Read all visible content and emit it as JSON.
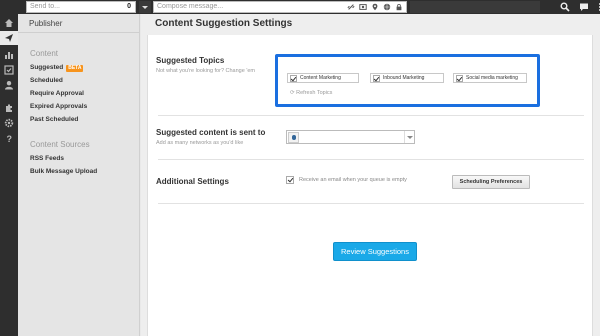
{
  "topbar": {
    "sendto_placeholder": "Send to...",
    "sendto_count": "0",
    "compose_placeholder": "Compose message...",
    "compose_icons": [
      "link-icon",
      "image-icon",
      "location-icon",
      "globe-icon",
      "lock-icon"
    ],
    "right_icons": [
      "search-icon",
      "chat-icon",
      "menu-icon"
    ]
  },
  "rail": {
    "icons": [
      "home-icon",
      "send-icon",
      "analytics-icon",
      "assignments-icon",
      "contacts-icon",
      "apps-icon",
      "settings-icon",
      "help-icon"
    ],
    "active": "send-icon"
  },
  "sidebar": {
    "header": "Publisher",
    "content_section": "Content",
    "items": [
      {
        "label": "Suggested",
        "badge": "BETA"
      },
      {
        "label": "Scheduled"
      },
      {
        "label": "Require Approval"
      },
      {
        "label": "Expired Approvals"
      },
      {
        "label": "Past Scheduled"
      }
    ],
    "sources_section": "Content Sources",
    "source_items": [
      {
        "label": "RSS Feeds"
      },
      {
        "label": "Bulk Message Upload"
      }
    ]
  },
  "main": {
    "title": "Content Suggestion Settings",
    "topics": {
      "title": "Suggested Topics",
      "subtitle": "Not what you're looking for? Change 'em",
      "items": [
        {
          "label": "Content Marketing",
          "checked": true
        },
        {
          "label": "Inbound Marketing",
          "checked": true
        },
        {
          "label": "Social media marketing",
          "checked": true
        }
      ],
      "refresh": "Refresh Topics"
    },
    "sent_to": {
      "title": "Suggested content is sent to",
      "subtitle": "Add as many networks as you'd like",
      "selected_value": ""
    },
    "additional": {
      "title": "Additional Settings",
      "email_label": "Receive an email when your queue is empty",
      "email_checked": true,
      "scheduling_button": "Scheduling Preferences"
    },
    "review_button": "Review Suggestions"
  },
  "colors": {
    "accent": "#1aa9e8",
    "highlight_box": "#1a6fe0",
    "beta_badge": "#f7941d",
    "rail_bg": "#2e2e2e"
  }
}
